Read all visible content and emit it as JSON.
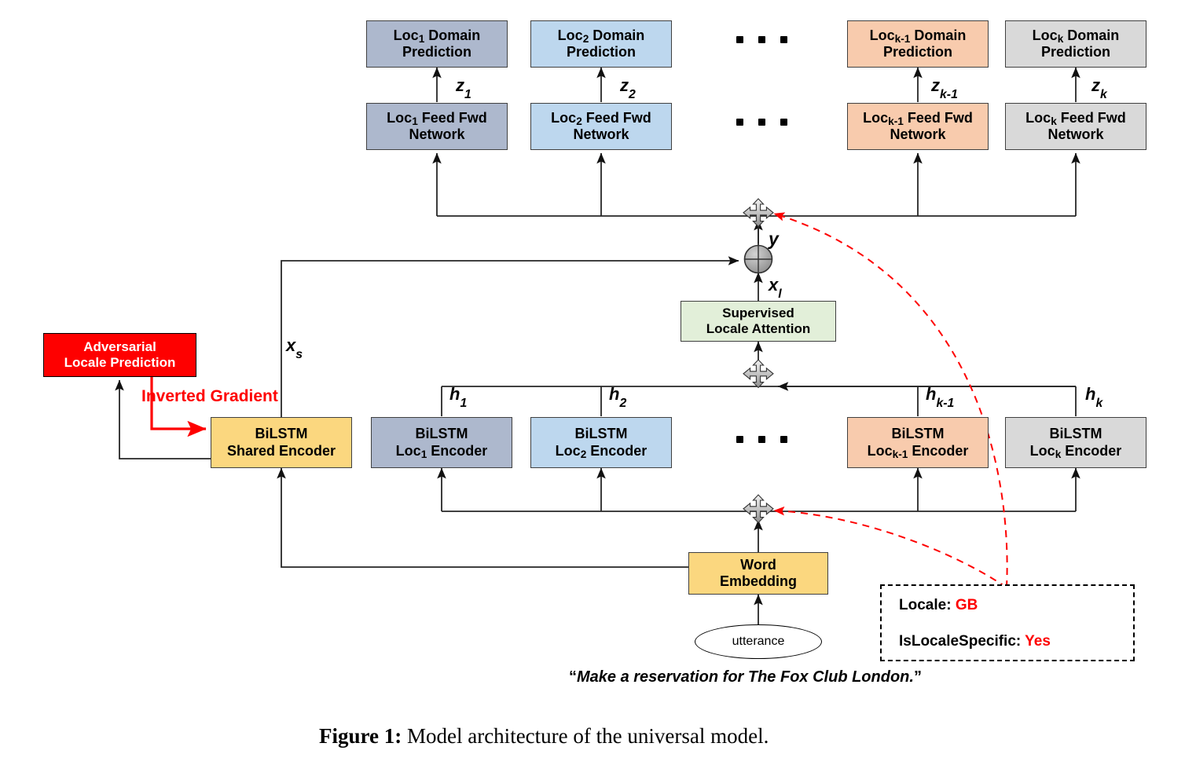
{
  "figure": {
    "caption_label": "Figure 1:",
    "caption_text": " Model architecture of the universal model."
  },
  "columns": [
    {
      "id": "loc1",
      "color": "#adb8cd",
      "domain_prediction": {
        "line1_pre": "Loc",
        "line1_sub": "1",
        "line1_post": " Domain",
        "line2": "Prediction"
      },
      "feed_fwd": {
        "line1_pre": "Loc",
        "line1_sub": "1",
        "line1_post": " Feed Fwd",
        "line2": "Network"
      },
      "encoder": {
        "line1": "BiLSTM",
        "line2_pre": "Loc",
        "line2_sub": "1",
        "line2_post": " Encoder"
      },
      "z_label": "z",
      "z_sub": "1",
      "h_label": "h",
      "h_sub": "1"
    },
    {
      "id": "loc2",
      "color": "#bdd7ee",
      "domain_prediction": {
        "line1_pre": "Loc",
        "line1_sub": "2",
        "line1_post": " Domain",
        "line2": "Prediction"
      },
      "feed_fwd": {
        "line1_pre": "Loc",
        "line1_sub": "2",
        "line1_post": " Feed Fwd",
        "line2": "Network"
      },
      "encoder": {
        "line1": "BiLSTM",
        "line2_pre": "Loc",
        "line2_sub": "2",
        "line2_post": " Encoder"
      },
      "z_label": "z",
      "z_sub": "2",
      "h_label": "h",
      "h_sub": "2"
    },
    {
      "id": "lockm1",
      "color": "#f8cbad",
      "domain_prediction": {
        "line1_pre": "Loc",
        "line1_sub": "k-1",
        "line1_post": " Domain",
        "line2": "Prediction"
      },
      "feed_fwd": {
        "line1_pre": "Loc",
        "line1_sub": "k-1",
        "line1_post": " Feed Fwd",
        "line2": "Network"
      },
      "encoder": {
        "line1": "BiLSTM",
        "line2_pre": "Loc",
        "line2_sub": "k-1",
        "line2_post": " Encoder"
      },
      "z_label": "z",
      "z_sub": "k-1",
      "h_label": "h",
      "h_sub": "k-1"
    },
    {
      "id": "lock",
      "color": "#d9d9d9",
      "domain_prediction": {
        "line1_pre": "Loc",
        "line1_sub": "k",
        "line1_post": " Domain",
        "line2": "Prediction"
      },
      "feed_fwd": {
        "line1_pre": "Loc",
        "line1_sub": "k",
        "line1_post": " Feed Fwd",
        "line2": "Network"
      },
      "encoder": {
        "line1": "BiLSTM",
        "line2_pre": "Loc",
        "line2_sub": "k",
        "line2_post": " Encoder"
      },
      "z_label": "z",
      "z_sub": "k",
      "h_label": "h",
      "h_sub": "k"
    }
  ],
  "blocks": {
    "attention": {
      "line1": "Supervised",
      "line2": "Locale Attention",
      "color": "#e2efd9"
    },
    "shared_encoder": {
      "line1": "BiLSTM",
      "line2": "Shared Encoder",
      "color": "#fbd77f"
    },
    "word_embedding": {
      "line1": "Word",
      "line2": "Embedding",
      "color": "#fbd77f"
    },
    "adversarial": {
      "line1": "Adversarial",
      "line2": "Locale Prediction",
      "color": "#fe0000"
    },
    "utterance": {
      "label": "utterance"
    }
  },
  "labels": {
    "inverted_gradient": "Inverted Gradient",
    "y": "y",
    "x_l": "x",
    "x_l_sub": "l",
    "x_s": "x",
    "x_s_sub": "s",
    "ellipsis": "..."
  },
  "locale_info": {
    "locale_key": "Locale: ",
    "locale_value": "GB",
    "specific_key": "IsLocaleSpecific: ",
    "specific_value": "Yes"
  },
  "utterance_sentence": {
    "open_quote": "“",
    "text": "Make a reservation for The Fox Club London.",
    "close_quote": "”"
  },
  "colors": {
    "accent_red": "#fe0000",
    "wire": "#262626",
    "junction_fill": "#a6a6a6"
  }
}
